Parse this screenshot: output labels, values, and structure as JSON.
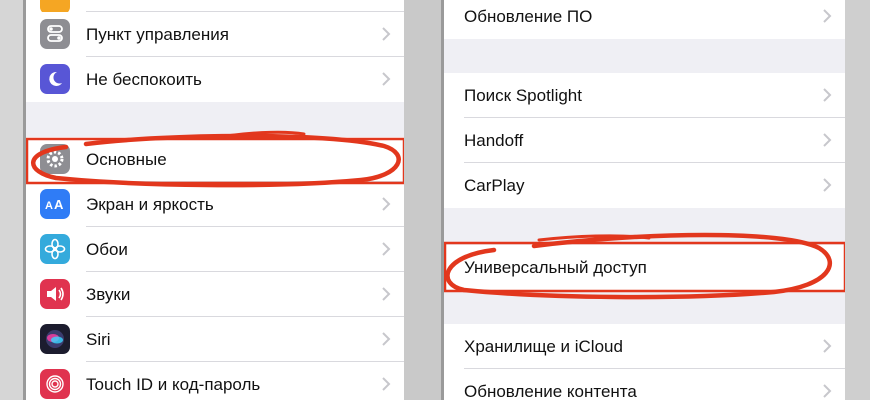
{
  "left_screen": {
    "items": [
      {
        "label": "Пункт управления",
        "icon": "control-center-icon",
        "color": "#8e8e93"
      },
      {
        "label": "Не беспокоить",
        "icon": "moon-icon",
        "color": "#5856d6"
      },
      {
        "label": "Основные",
        "icon": "gear-icon",
        "color": "#8e8e93"
      },
      {
        "label": "Экран и яркость",
        "icon": "text-size-icon",
        "color": "#2f7cf6"
      },
      {
        "label": "Обои",
        "icon": "flower-icon",
        "color": "#34aadc"
      },
      {
        "label": "Звуки",
        "icon": "speaker-icon",
        "color": "#e0334f"
      },
      {
        "label": "Siri",
        "icon": "siri-icon",
        "color": "#1c1c2e"
      },
      {
        "label": "Touch ID и код-пароль",
        "icon": "fingerprint-icon",
        "color": "#e0334f"
      }
    ]
  },
  "right_screen": {
    "items": [
      {
        "label": "Обновление ПО"
      },
      {
        "label": "Поиск Spotlight"
      },
      {
        "label": "Handoff"
      },
      {
        "label": "CarPlay"
      },
      {
        "label": "Универсальный доступ"
      },
      {
        "label": "Хранилище и iCloud"
      },
      {
        "label": "Обновление контента"
      }
    ]
  },
  "colors": {
    "annotation": "#e2371d",
    "background": "#efeff4"
  }
}
